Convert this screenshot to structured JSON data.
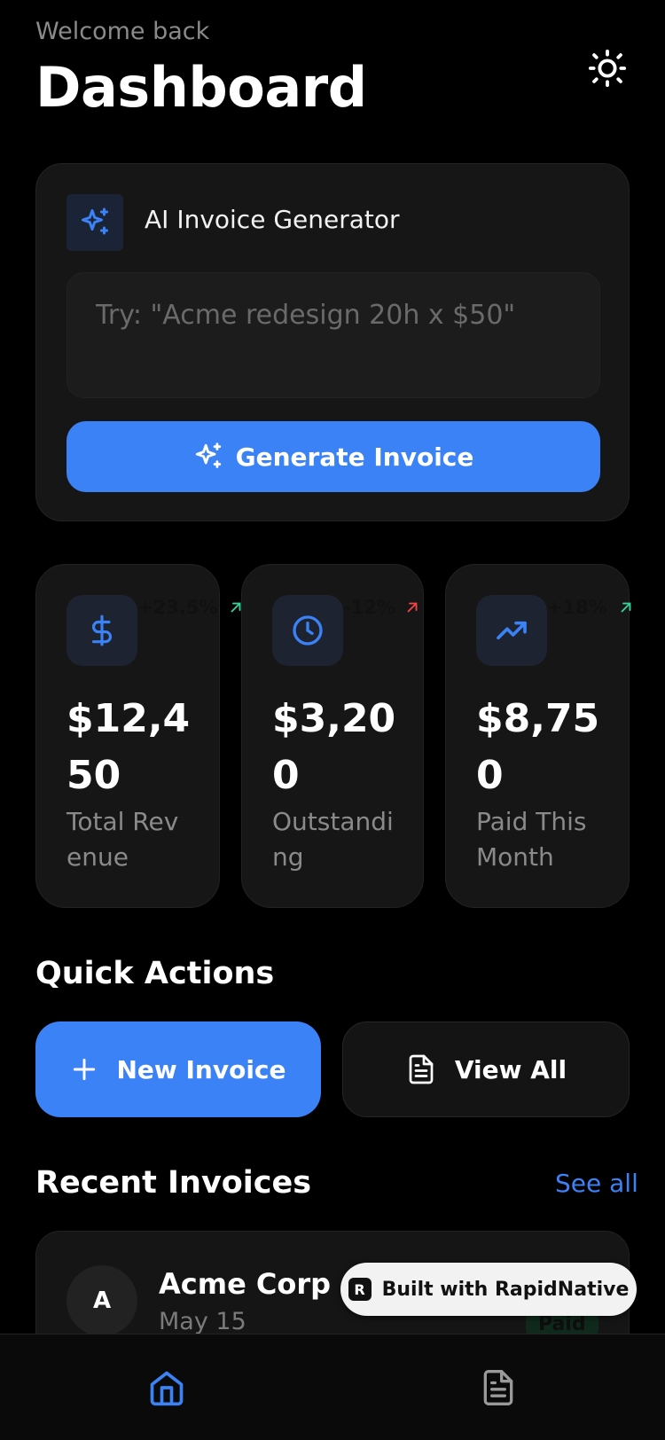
{
  "header": {
    "welcome": "Welcome back",
    "title": "Dashboard",
    "theme_icon": "sun-icon"
  },
  "ai_generator": {
    "title": "AI Invoice Generator",
    "icon": "sparkles-icon",
    "placeholder": "Try: \"Acme redesign 20h x $50\"",
    "button_label": "Generate Invoice"
  },
  "stats": [
    {
      "icon": "dollar-icon",
      "change": "+23.5%",
      "change_color": "#34d399",
      "value": "$12,450",
      "label": "Total Revenue"
    },
    {
      "icon": "clock-icon",
      "change": "-12%",
      "change_color": "#ef4444",
      "value": "$3,200",
      "label": "Outstanding"
    },
    {
      "icon": "trending-up-icon",
      "change": "+18%",
      "change_color": "#34d399",
      "value": "$8,750",
      "label": "Paid This Month"
    }
  ],
  "quick_actions": {
    "title": "Quick Actions",
    "new_invoice": "New Invoice",
    "view_all": "View All"
  },
  "recent_invoices": {
    "title": "Recent Invoices",
    "see_all": "See all",
    "items": [
      {
        "avatar": "A",
        "name": "Acme Corp",
        "date": "May 15",
        "status": "Paid"
      }
    ]
  },
  "badge": {
    "text": "Built with RapidNative"
  },
  "tabbar": {
    "tabs": [
      {
        "icon": "home-icon",
        "active": true
      },
      {
        "icon": "document-icon",
        "active": false
      }
    ]
  },
  "colors": {
    "accent": "#3b82f6",
    "background": "#000000",
    "card": "#161616",
    "positive": "#34d399",
    "negative": "#ef4444"
  }
}
